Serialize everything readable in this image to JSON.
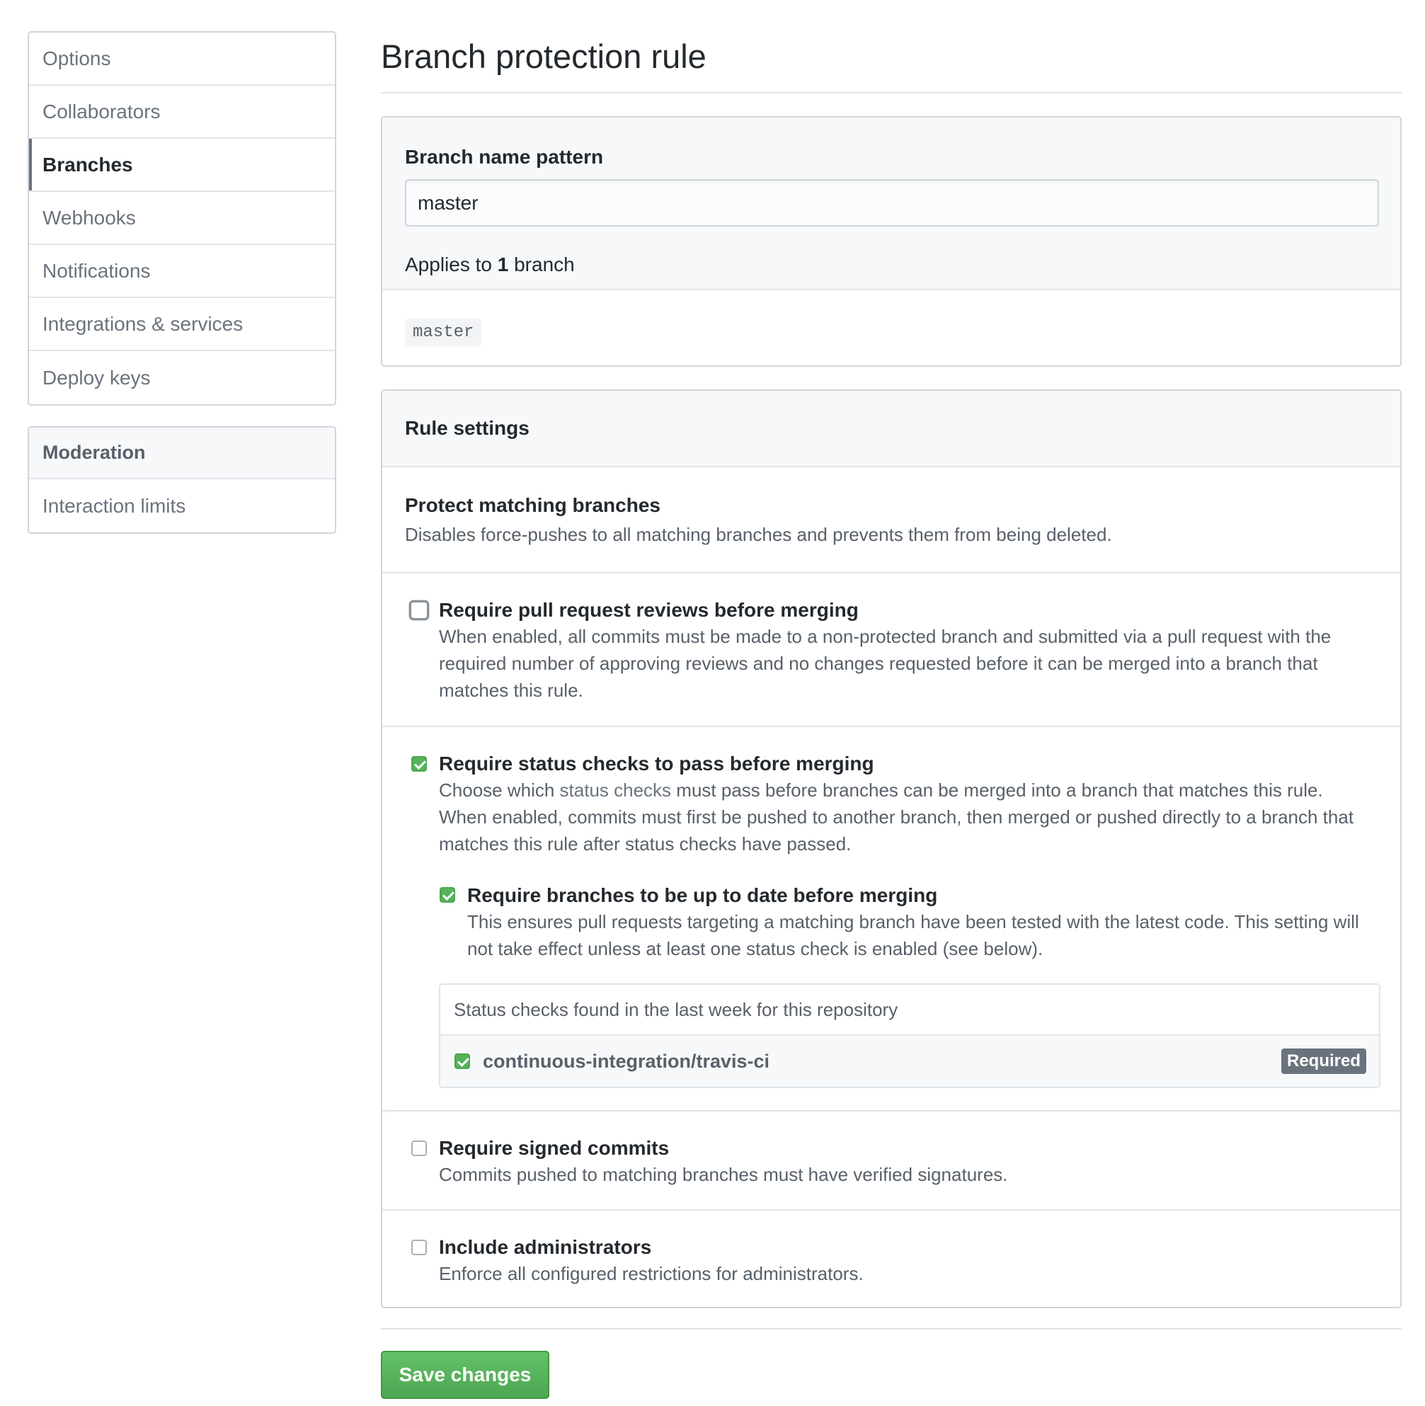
{
  "sidebar": {
    "items": [
      {
        "label": "Options"
      },
      {
        "label": "Collaborators"
      },
      {
        "label": "Branches"
      },
      {
        "label": "Webhooks"
      },
      {
        "label": "Notifications"
      },
      {
        "label": "Integrations & services"
      },
      {
        "label": "Deploy keys"
      }
    ],
    "selected": "Branches",
    "moderation": {
      "heading": "Moderation",
      "items": [
        {
          "label": "Interaction limits"
        }
      ]
    }
  },
  "page": {
    "title": "Branch protection rule"
  },
  "pattern": {
    "label": "Branch name pattern",
    "value": "master",
    "applies_prefix": "Applies to",
    "applies_count": "1",
    "applies_suffix": "branch",
    "matched_branch": "master"
  },
  "rules": {
    "heading": "Rule settings",
    "protect": {
      "title": "Protect matching branches",
      "desc": "Disables force-pushes to all matching branches and prevents them from being deleted."
    },
    "reviews": {
      "title": "Require pull request reviews before merging",
      "desc": "When enabled, all commits must be made to a non-protected branch and submitted via a pull request with the required number of approving reviews and no changes requested before it can be merged into a branch that matches this rule.",
      "checked": false
    },
    "status": {
      "title": "Require status checks to pass before merging",
      "desc_prefix": "Choose which",
      "desc_link": "status checks",
      "desc_suffix": "must pass before branches can be merged into a branch that matches this rule. When enabled, commits must first be pushed to another branch, then merged or pushed directly to a branch that matches this rule after status checks have passed.",
      "checked": true,
      "uptodate": {
        "title": "Require branches to be up to date before merging",
        "desc": "This ensures pull requests targeting a matching branch have been tested with the latest code. This setting will not take effect unless at least one status check is enabled (see below).",
        "checked": true
      },
      "checks": {
        "heading": "Status checks found in the last week for this repository",
        "items": [
          {
            "name": "continuous-integration/travis-ci",
            "badge": "Required",
            "checked": true
          }
        ]
      }
    },
    "signed": {
      "title": "Require signed commits",
      "desc": "Commits pushed to matching branches must have verified signatures.",
      "checked": false
    },
    "admins": {
      "title": "Include administrators",
      "desc": "Enforce all configured restrictions for administrators.",
      "checked": false
    }
  },
  "actions": {
    "save_label": "Save changes"
  },
  "colors": {
    "primary_button": "#4ea552",
    "checkbox_checked": "#56b35a",
    "badge": "#6a737d"
  }
}
